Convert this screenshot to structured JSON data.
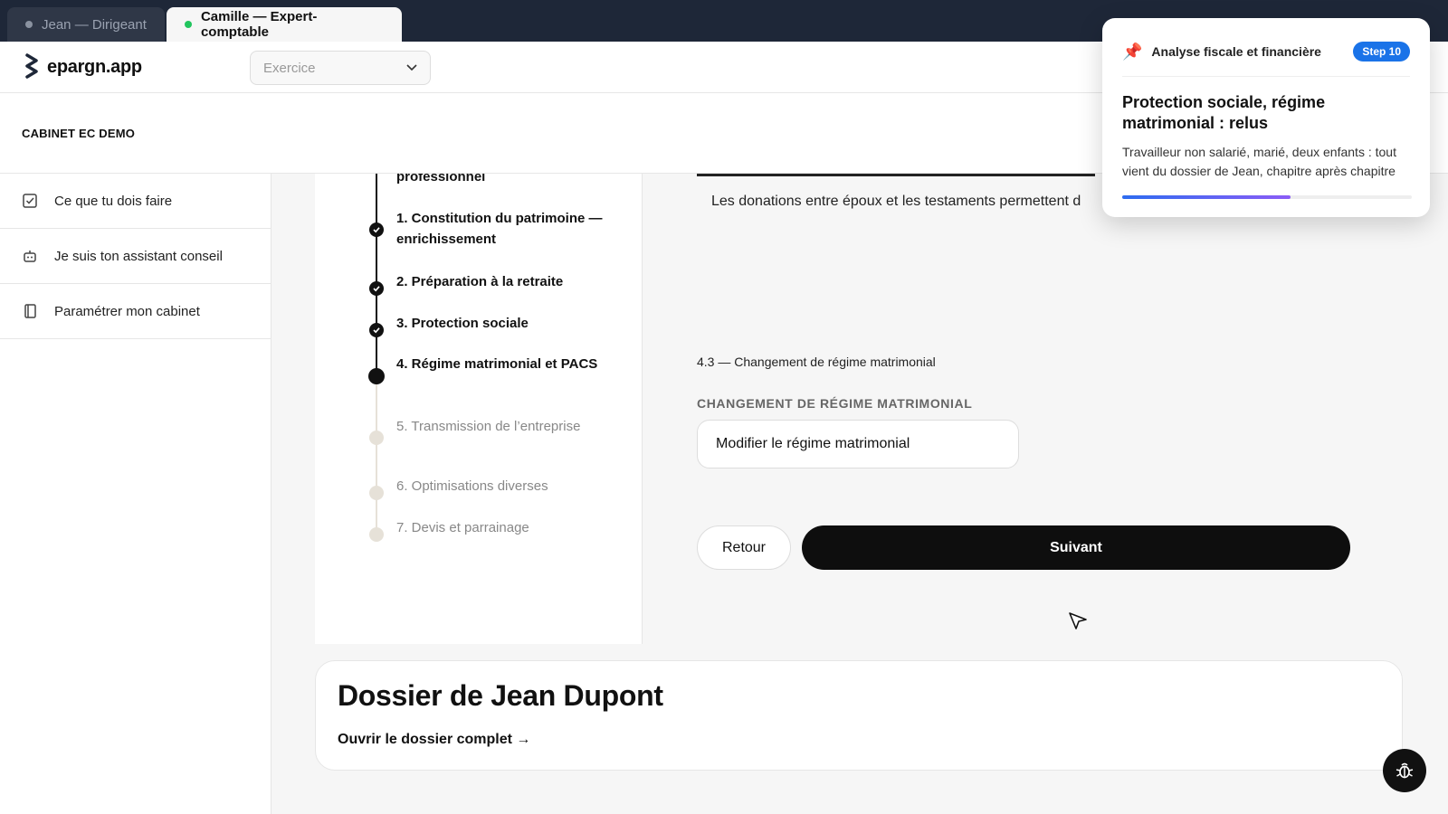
{
  "tabs": [
    {
      "label": "Jean — Dirigeant",
      "active": false,
      "dot_color": "#8a92a0"
    },
    {
      "label": "Camille — Expert-comptable",
      "active": true,
      "dot_color": "#22c55e"
    }
  ],
  "topbar": {
    "logo_text": "epargn.app",
    "exercise_select": {
      "placeholder": "Exercice"
    }
  },
  "cabinet": {
    "name": "CABINET EC DEMO"
  },
  "sidebar": {
    "items": [
      {
        "label": "Ce que tu dois faire",
        "icon": "checkbox-icon"
      },
      {
        "label": "Je suis ton assistant conseil",
        "icon": "robot-icon"
      },
      {
        "label": "Paramétrer mon cabinet",
        "icon": "book-icon"
      }
    ]
  },
  "stepper": {
    "partial_previous": "professionnel",
    "steps": [
      {
        "label": "1. Constitution du patrimoine — enrichissement",
        "state": "done"
      },
      {
        "label": "2. Préparation à la retraite",
        "state": "done"
      },
      {
        "label": "3. Protection sociale",
        "state": "done"
      },
      {
        "label": "4. Régime matrimonial et PACS",
        "state": "current"
      },
      {
        "label": "5. Transmission de l’entreprise",
        "state": "future"
      },
      {
        "label": "6. Optimisations diverses",
        "state": "future"
      },
      {
        "label": "7. Devis et parrainage",
        "state": "future"
      }
    ]
  },
  "main": {
    "donation_text": "Les donations entre époux et les testaments permettent d",
    "section_sub": "4.3 — Changement de régime matrimonial",
    "field_label": "CHANGEMENT DE RÉGIME MATRIMONIAL",
    "field_value": "Modifier le régime matrimonial",
    "back_label": "Retour",
    "next_label": "Suivant"
  },
  "dossier": {
    "title": "Dossier de Jean Dupont",
    "link": "Ouvrir le dossier complet →"
  },
  "guide": {
    "section": "Analyse fiscale et financière",
    "step_badge": "Step 10",
    "title": "Protection sociale, régime matrimonial : relus",
    "description": "Travailleur non salarié, marié, deux enfants : tout vient du dossier de Jean, chapitre après chapitre",
    "progress_percent": 58,
    "icon": "pushpin-icon"
  },
  "colors": {
    "accent_blue": "#1a73e8",
    "tabstrip_bg": "#1e2738",
    "primary_button": "#0e0e0e",
    "future_step": "#e6e1d8"
  }
}
